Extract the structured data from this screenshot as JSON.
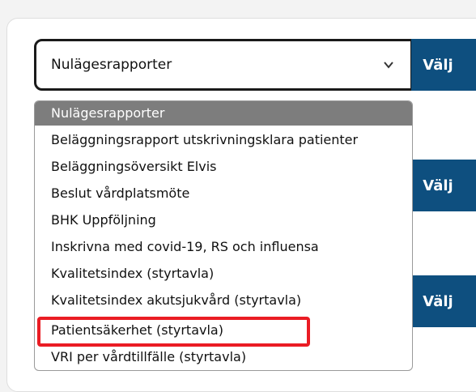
{
  "report_select": {
    "value": "Nulägesrapporter",
    "icon": "chevron-down-icon"
  },
  "buttons": {
    "choose_label": "Välj"
  },
  "dropdown": {
    "options": [
      "Nulägesrapporter",
      "Beläggningsrapport utskrivningsklara patienter",
      "Beläggningsöversikt Elvis",
      "Beslut vårdplatsmöte",
      "BHK Uppföljning",
      "Inskrivna med covid-19, RS och influensa",
      "Kvalitetsindex (styrtavla)",
      "Kvalitetsindex akutsjukvård (styrtavla)",
      "Patientsäkerhet (styrtavla)",
      "VRI per vårdtillfälle (styrtavla)"
    ],
    "selected_index": 0,
    "highlighted_option": "Patientsäkerhet (styrtavla)"
  },
  "colors": {
    "button_bg": "#0e4f7f",
    "selected_option_bg": "#7d7d7d",
    "highlight_border": "#ea1c24"
  }
}
